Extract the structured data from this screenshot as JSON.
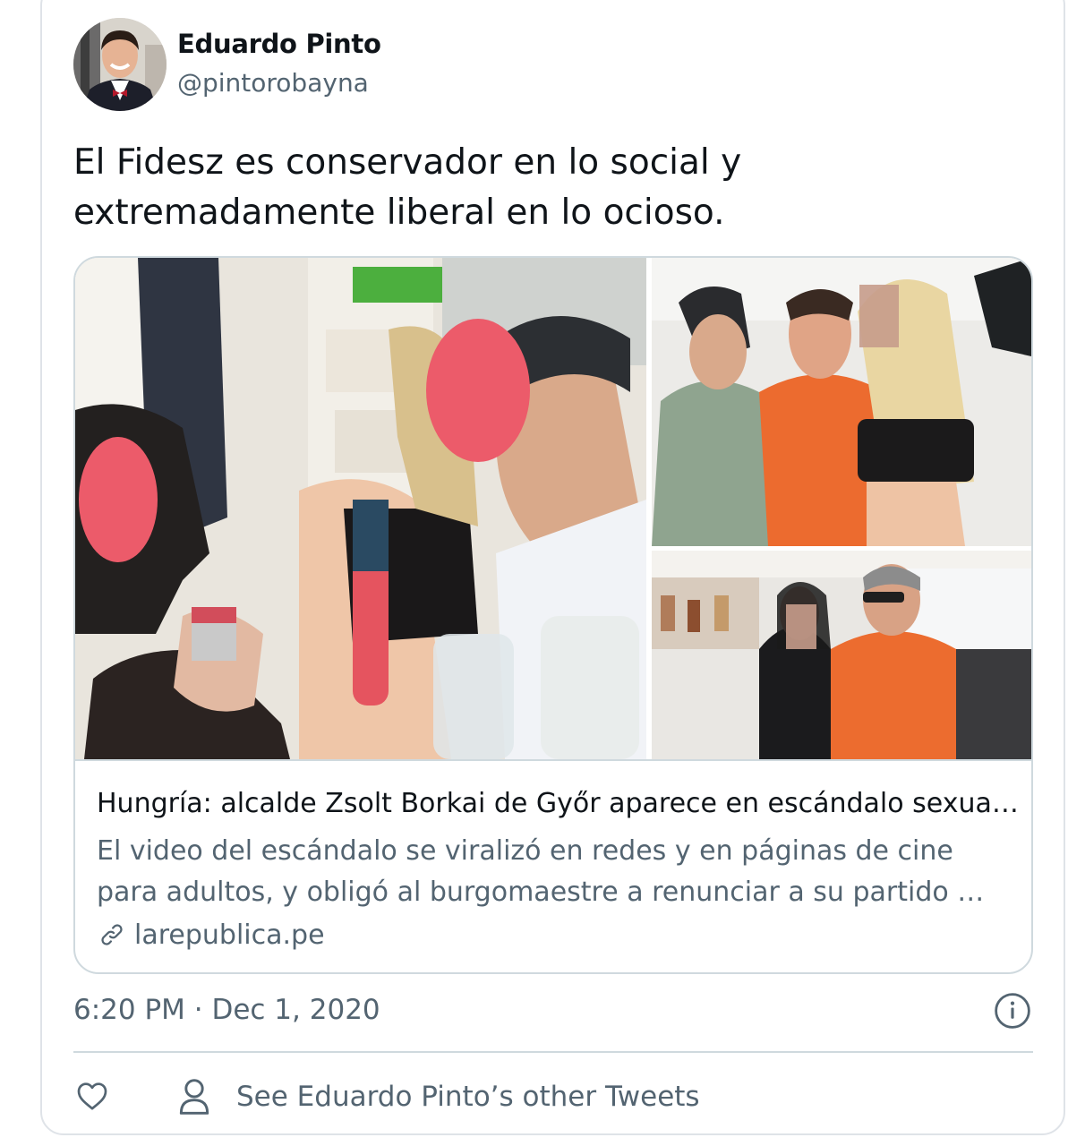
{
  "author": {
    "display_name": "Eduardo Pinto",
    "handle": "@pintorobayna"
  },
  "tweet": {
    "text": "El Fidesz es conservador en lo social y extremadamente liberal en lo ocioso.",
    "timestamp": "6:20 PM · Dec 1, 2020"
  },
  "link_card": {
    "title": "Hungría: alcalde Zsolt Borkai de Győr aparece en escándalo sexua…",
    "description": "El video del escándalo se viralizó en redes y en páginas de cine para adultos, y obligó al burgomaestre a renunciar a su partido …",
    "domain": "larepublica.pe"
  },
  "actions": {
    "other_tweets_label": "See Eduardo Pinto’s other Tweets"
  },
  "icons": {
    "info": "info-icon",
    "like": "heart-icon",
    "profile": "person-icon",
    "link": "link-icon"
  },
  "colors": {
    "text_primary": "#0f1419",
    "text_secondary": "#536471",
    "border": "#cfd9de"
  }
}
